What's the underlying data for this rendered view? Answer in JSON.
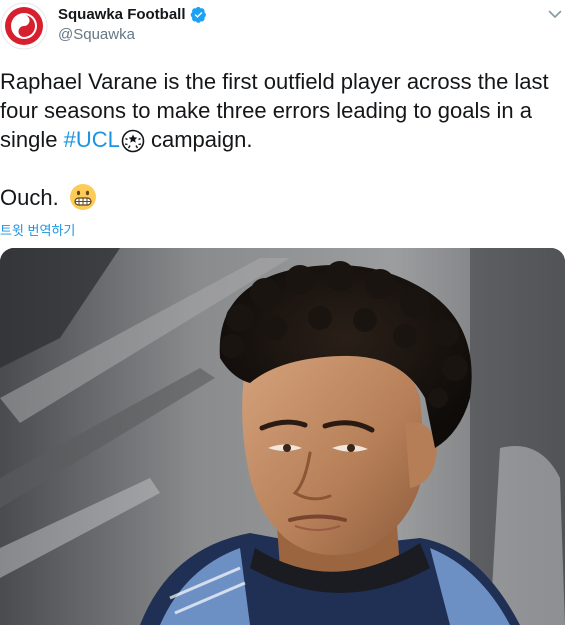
{
  "tweet": {
    "author": {
      "display_name": "Squawka Football",
      "handle": "@Squawka",
      "verified": true,
      "avatar_icon": "squawka-logo-icon",
      "brand_color": "#d6202f"
    },
    "menu_icon": "chevron-down-icon",
    "text_lines": [
      "Raphael Varane is the first outfield player across the last",
      "four seasons to make three errors leading to goals in a"
    ],
    "line3_prefix": "single ",
    "hashtag": "#UCL",
    "hashtag_emoji": "champions-league-ball-emoji",
    "line3_suffix": " campaign.",
    "ouch_text": "Ouch.",
    "ouch_emoji": "grimacing-face-emoji",
    "translate_label": "트윗 번역하기",
    "link_color": "#1b95e0"
  },
  "media": {
    "description": "photo",
    "subject_icon": "player-photo"
  }
}
